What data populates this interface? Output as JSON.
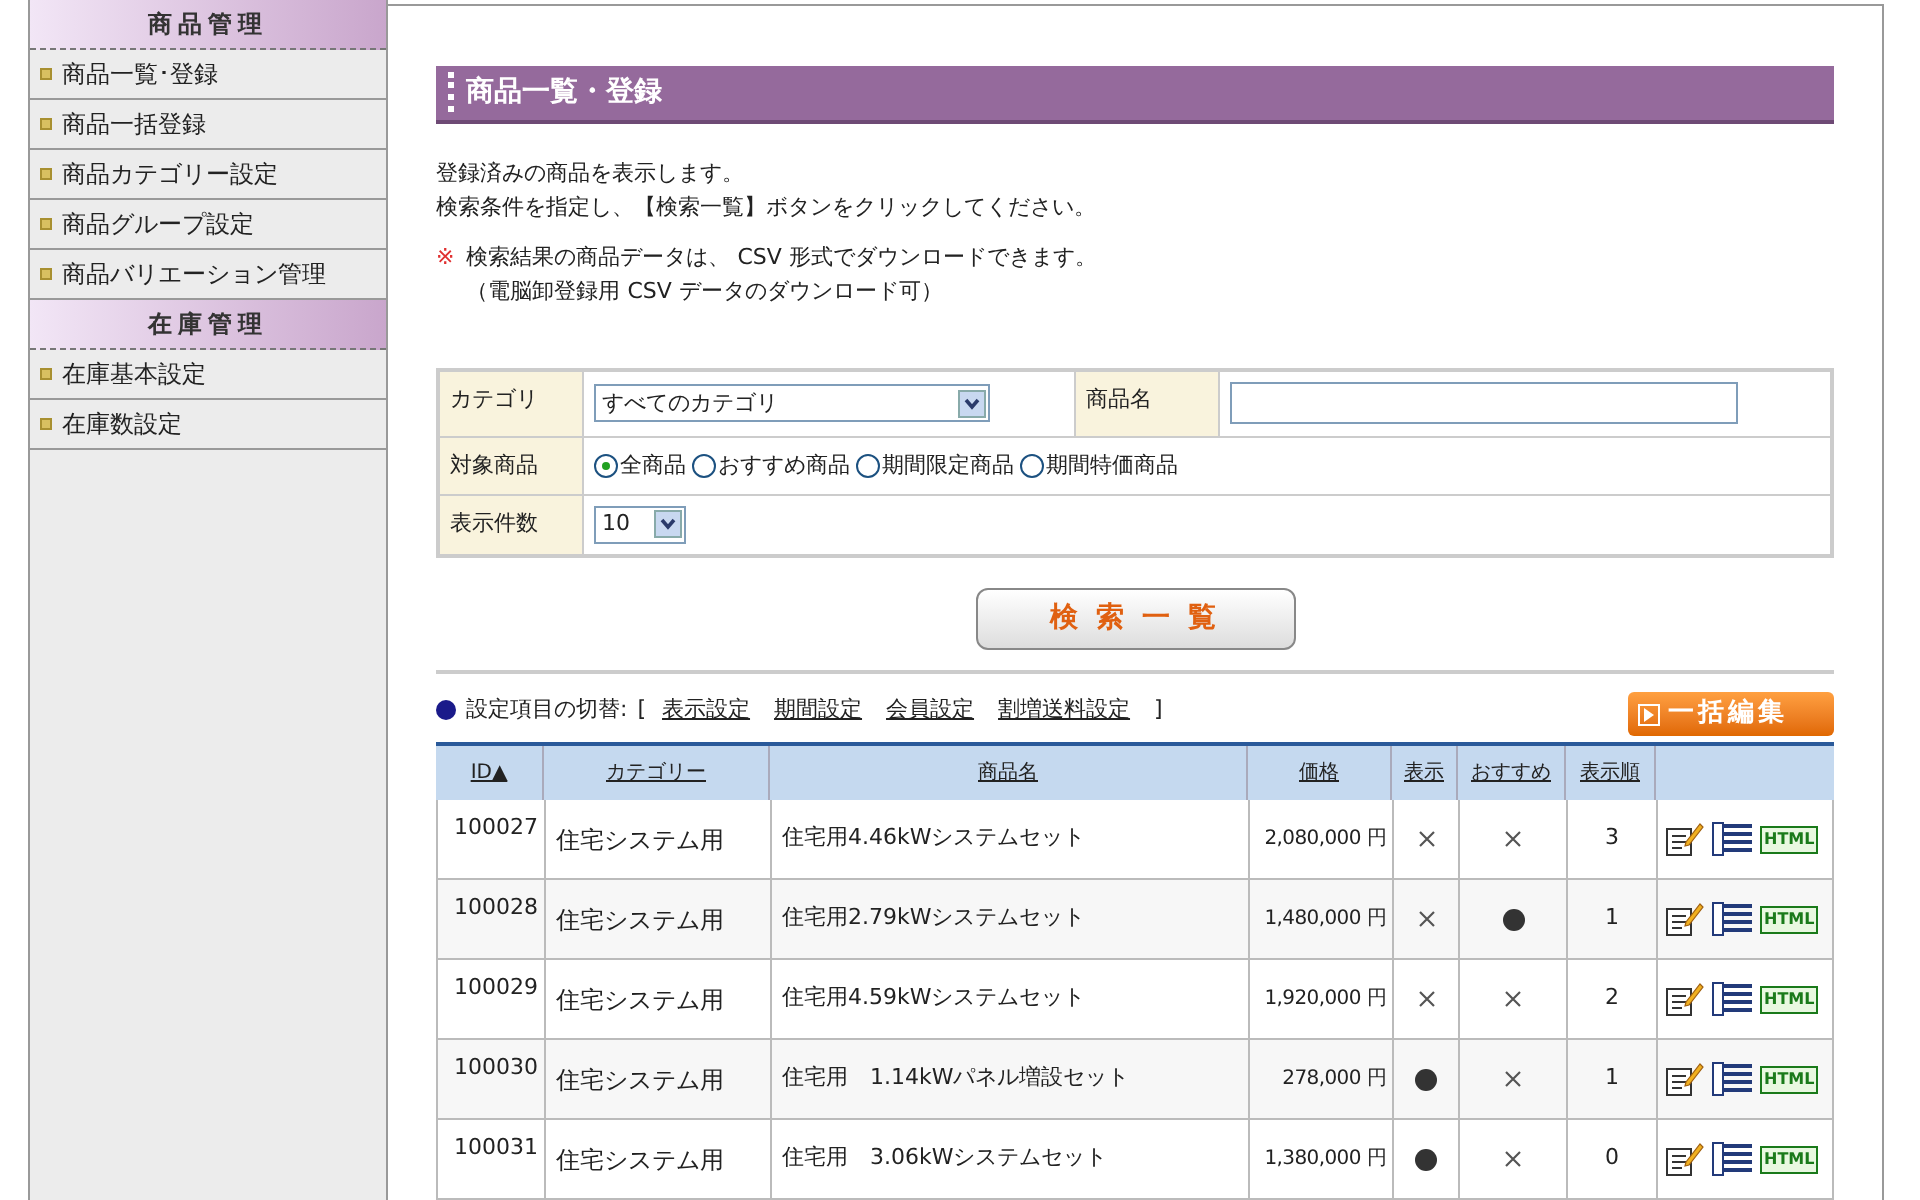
{
  "sidebar": {
    "sections": [
      {
        "title": "商品管理",
        "items": [
          {
            "label": "商品一覧･登録",
            "selected": false
          },
          {
            "label": "商品一括登録",
            "selected": false
          },
          {
            "label": "商品カテゴリー設定",
            "selected": false
          },
          {
            "label": "商品グループ設定",
            "selected": false
          },
          {
            "label": "商品バリエーション管理",
            "selected": false
          }
        ]
      },
      {
        "title": "在庫管理",
        "items": [
          {
            "label": "在庫基本設定",
            "selected": false
          },
          {
            "label": "在庫数設定",
            "selected": false
          }
        ]
      }
    ]
  },
  "page_title": "商品一覧・登録",
  "intro": [
    "登録済みの商品を表示します。",
    "検索条件を指定し、【検索一覧】ボタンをクリックしてください。"
  ],
  "note": {
    "mark": "※",
    "lines": [
      "検索結果の商品データは、 CSV 形式でダウンロードできます。",
      "（電脳卸登録用 CSV データのダウンロード可）"
    ]
  },
  "search": {
    "category_label": "カテゴリ",
    "category_value": "すべてのカテゴリ",
    "name_label": "商品名",
    "target_label": "対象商品",
    "targets": [
      {
        "label": "全商品",
        "selected": true
      },
      {
        "label": "おすすめ商品",
        "selected": false
      },
      {
        "label": "期間限定商品",
        "selected": false
      },
      {
        "label": "期間特価商品",
        "selected": false
      }
    ],
    "count_label": "表示件数",
    "count_value": "10",
    "button": "検 索 一 覧"
  },
  "switcher": {
    "label": "設定項目の切替:",
    "open": "[",
    "close": "]",
    "links": [
      "表示設定",
      "期間設定",
      "会員設定",
      "割増送料設定"
    ]
  },
  "bulk_edit": "一括編集",
  "table": {
    "columns": [
      "ID▲",
      "カテゴリー",
      "商品名",
      "価格",
      "表示",
      "おすすめ",
      "表示順"
    ],
    "rows": [
      {
        "id": "100027",
        "category": "住宅システム用",
        "name": "住宅用4.46kWシステムセット",
        "price": "2,080,000 円",
        "shown": false,
        "recommended": false,
        "order": "3",
        "html": "HTML"
      },
      {
        "id": "100028",
        "category": "住宅システム用",
        "name": "住宅用2.79kWシステムセット",
        "price": "1,480,000 円",
        "shown": false,
        "recommended": true,
        "order": "1",
        "html": "HTML"
      },
      {
        "id": "100029",
        "category": "住宅システム用",
        "name": "住宅用4.59kWシステムセット",
        "price": "1,920,000 円",
        "shown": false,
        "recommended": false,
        "order": "2",
        "html": "HTML"
      },
      {
        "id": "100030",
        "category": "住宅システム用",
        "name": "住宅用　1.14kWパネル増設セット",
        "price": "278,000 円",
        "shown": true,
        "recommended": false,
        "order": "1",
        "html": "HTML"
      },
      {
        "id": "100031",
        "category": "住宅システム用",
        "name": "住宅用　3.06kWシステムセット",
        "price": "1,380,000 円",
        "shown": true,
        "recommended": false,
        "order": "0",
        "html": "HTML"
      }
    ]
  }
}
